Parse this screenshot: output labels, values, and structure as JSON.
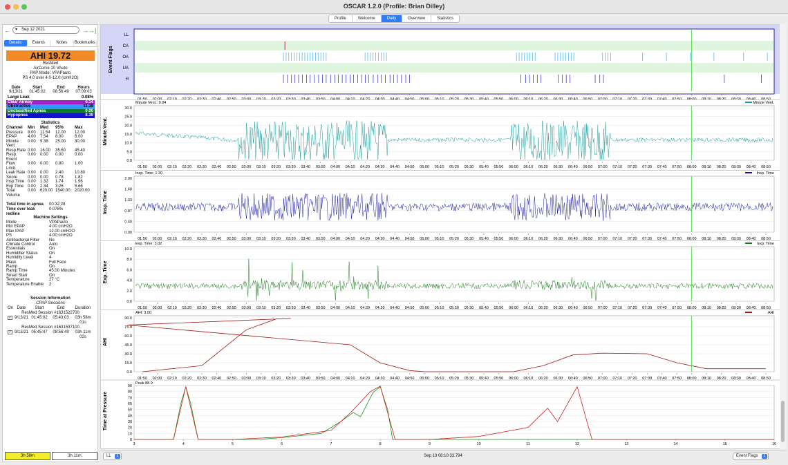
{
  "window": {
    "title": "OSCAR 1.2.0 (Profile: Brian Dilley)"
  },
  "tabs": [
    "Profile",
    "Welcome",
    "Daily",
    "Overview",
    "Statistics"
  ],
  "active_tab": "Daily",
  "nav": {
    "date": "Sep 12 2021",
    "prev": "←",
    "next": "→",
    "last": "→|"
  },
  "detail_tabs": [
    "Details",
    "Events",
    "Notes",
    "Bookmarks"
  ],
  "ahi": "AHI 19.72",
  "device": {
    "brand": "ResMed",
    "model": "AirCurve 10 VAuto",
    "mode": "PAP Mode: VPAPauto",
    "pressure": "PS 4.0 over 4.0-12.0 (cmH2O)"
  },
  "session_summary": {
    "headers": [
      "Date",
      "Start",
      "End",
      "Hours"
    ],
    "values": [
      "9/13/21",
      "01:45:02",
      "08:56:49",
      "07:09:03"
    ]
  },
  "indices": [
    {
      "name": "Large Leak",
      "value": "0.08%",
      "bg": "#ffffff",
      "fg": "#000000"
    },
    {
      "name": "Clear Airway",
      "value": "0.14",
      "bg": "#a41ec8",
      "fg": "#ffffff"
    },
    {
      "name": "Obstructive",
      "value": "11.19",
      "bg": "#3399ff",
      "fg": "#000000"
    },
    {
      "name": "Unclassified Apnea",
      "value": "0.00",
      "bg": "#0d7a26",
      "fg": "#ffffff"
    },
    {
      "name": "Hypopnea",
      "value": "8.39",
      "bg": "#1111cc",
      "fg": "#ffffff"
    }
  ],
  "statistics": {
    "title": "Statistics",
    "headers": [
      "Channel",
      "Min",
      "Med",
      "95%",
      "Max"
    ],
    "rows": [
      [
        "Pressure",
        "8.00",
        "11.54",
        "12.00",
        "12.00"
      ],
      [
        "EPAP",
        "4.00",
        "7.54",
        "8.00",
        "8.00"
      ],
      [
        "Minute",
        "0.00",
        "9.38",
        "25.00",
        "30.00"
      ],
      [
        "Vent.",
        "",
        "",
        "",
        ""
      ],
      [
        "Resp.Rate",
        "0.00",
        "16.00",
        "35.60",
        "45.40"
      ],
      [
        "Resp.",
        "0.00",
        "0.00",
        "0.00",
        "0.00"
      ],
      [
        "Event",
        "",
        "",
        "",
        ""
      ],
      [
        "Flow",
        "0.00",
        "0.00",
        "0.80",
        "1.00"
      ],
      [
        "Limit.",
        "",
        "",
        "",
        ""
      ],
      [
        "Leak Rate",
        "0.00",
        "0.00",
        "2.40",
        "10.80"
      ],
      [
        "Snore",
        "0.00",
        "0.00",
        "0.78",
        "1.82"
      ],
      [
        "Insp.Time",
        "0.00",
        "1.32",
        "1.74",
        "1.96"
      ],
      [
        "Exp.Time",
        "0.00",
        "2.34",
        "3.26",
        "5.66"
      ],
      [
        "Total",
        "0.00",
        "620.00",
        "1540.00",
        "2020.00"
      ],
      [
        "Volume",
        "",
        "",
        "",
        ""
      ]
    ]
  },
  "apnea": [
    {
      "label": "Total time in apnea",
      "value": "00:32:28"
    },
    {
      "label": "Time over leak redline",
      "value": "0.078%"
    }
  ],
  "machine_settings": {
    "title": "Machine Settings",
    "rows": [
      [
        "Mode",
        "VPAPauto"
      ],
      [
        "Min EPAP",
        "4.00 cmH2O"
      ],
      [
        "Max IPAP",
        "12.00 cmH2O"
      ],
      [
        "PS",
        "4.00 cmH2O"
      ],
      [
        "Antibacterial Filter",
        "No"
      ],
      [
        "Climate Control",
        "Auto"
      ],
      [
        "Essentials",
        "On"
      ],
      [
        "Humidifier Status",
        "On"
      ],
      [
        "Humidity Level",
        "4"
      ],
      [
        "Mask",
        "Full Face"
      ],
      [
        "Ramp",
        "On"
      ],
      [
        "Ramp Time",
        "45.00 Minutes"
      ],
      [
        "Smart Start",
        "On"
      ],
      [
        "Temperature",
        "27 °C"
      ],
      [
        "Temperature Enable",
        "2"
      ]
    ]
  },
  "session_info": {
    "title": "Session Information",
    "cpap_title": "CPAP Sessions",
    "headers": [
      "On",
      "Date",
      "Start",
      "End",
      "Duration"
    ],
    "sessions": [
      {
        "name": "ResMed Session #1631522700",
        "date": "9/13/21",
        "start": "01:45:02",
        "end": "05:43:03",
        "duration": "03h 58m 01s"
      },
      {
        "name": "ResMed Session #1631537100",
        "date": "9/13/21",
        "start": "05:45:47",
        "end": "08:56:49",
        "duration": "03h 11m 02s"
      }
    ]
  },
  "bottom_buttons": [
    "3h 58m",
    "3h 11m"
  ],
  "time_ticks": [
    "01:50",
    "02:00",
    "02:10",
    "02:20",
    "02:30",
    "02:40",
    "02:50",
    "03:00",
    "03:10",
    "03:20",
    "03:30",
    "03:40",
    "03:50",
    "04:00",
    "04:10",
    "04:20",
    "04:30",
    "04:40",
    "04:50",
    "05:00",
    "05:10",
    "05:20",
    "05:30",
    "05:40",
    "05:50",
    "06:00",
    "06:10",
    "06:20",
    "06:30",
    "06:40",
    "06:50",
    "07:00",
    "07:10",
    "07:20",
    "07:30",
    "07:40",
    "07:50",
    "08:00",
    "08:10",
    "08:20",
    "08:30",
    "08:40",
    "08:50"
  ],
  "event_flags": {
    "title": "Event Flags",
    "rows": [
      "LL",
      "CA",
      "OA",
      "UA",
      "H"
    ]
  },
  "charts": [
    {
      "title": "Minute Vent.",
      "header": "Minute Vent.: 9.04",
      "legend": "Minute Vent.",
      "color": "#1a9a9a",
      "yticks": [
        "0.0",
        "5.0",
        "10.0",
        "15.0",
        "20.0",
        "25.0",
        "30.0"
      ],
      "ymin": 0,
      "ymax": 30
    },
    {
      "title": "Insp. Time",
      "header": "Insp. Time: 1.30",
      "legend": "Insp. Time",
      "color": "#1a1a9a",
      "yticks": [
        "0.00",
        "0.40",
        "0.87",
        "1.33",
        "1.60",
        "2.00"
      ],
      "ymin": 0.4,
      "ymax": 2.0
    },
    {
      "title": "Exp. Time",
      "header": "Exp. Time: 3.02",
      "legend": "Exp. Time",
      "color": "#157a15",
      "yticks": [
        "0.0",
        "2.0",
        "4.0",
        "6.0",
        "8.0",
        "10.0"
      ],
      "ymin": 0,
      "ymax": 10
    },
    {
      "title": "AHI",
      "header": "AHI: 3.00",
      "legend": "AHI",
      "color": "#a01818",
      "yticks": [
        "0.0",
        "15.0",
        "30.0",
        "45.0",
        "60.0",
        "75.0",
        "90.0"
      ],
      "ymin": 0,
      "ymax": 90
    }
  ],
  "pressure_chart": {
    "title": "Time at Pressure",
    "header": "Peak 88.9",
    "xticks": [
      "3",
      "4",
      "5",
      "6",
      "7",
      "8",
      "9",
      "10",
      "11",
      "12",
      "13",
      "14",
      "15",
      "16"
    ],
    "yticks": [
      "0",
      "10",
      "20",
      "30",
      "40",
      "50",
      "60",
      "70",
      "80",
      "90"
    ]
  },
  "status": {
    "left_select": "LL",
    "time": "Sep 13 08:10:33.794",
    "right_select": "Event Flags"
  },
  "chart_data": [
    {
      "type": "line",
      "title": "AHI",
      "x": [
        "01:50",
        "02:30",
        "03:00",
        "03:20",
        "03:30",
        "03:45",
        "04:10",
        "04:30",
        "04:50",
        "05:00",
        "06:00",
        "06:20",
        "06:40",
        "07:00",
        "07:30",
        "07:50",
        "08:10",
        "08:50"
      ],
      "series": [
        {
          "name": "AHI",
          "values": [
            0,
            10,
            70,
            88,
            89,
            78,
            45,
            15,
            2,
            0,
            0,
            10,
            28,
            31,
            30,
            15,
            5,
            5
          ]
        }
      ],
      "ylim": [
        0,
        90
      ]
    },
    {
      "type": "line",
      "title": "Time at Pressure",
      "x": [
        3,
        3.8,
        4.05,
        4.3,
        5,
        6,
        7,
        7.4,
        7.8,
        8.0,
        8.3,
        9,
        10,
        11,
        11.4,
        11.6,
        12.0,
        12.3,
        16
      ],
      "series": [
        {
          "name": "Time at Pressure",
          "values": [
            0,
            0,
            88,
            0,
            0,
            4,
            15,
            45,
            80,
            89,
            0,
            0,
            5,
            20,
            52,
            30,
            88,
            0,
            0
          ]
        }
      ],
      "ylim": [
        0,
        90
      ]
    }
  ]
}
